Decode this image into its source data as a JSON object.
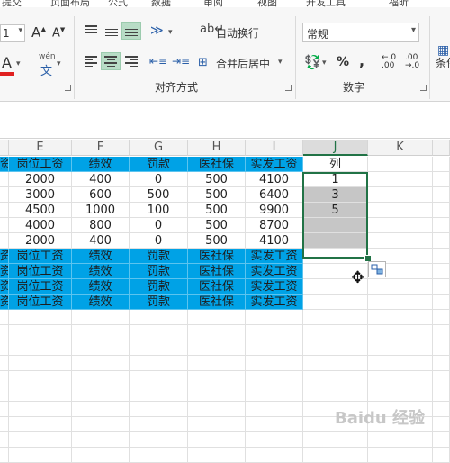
{
  "menu": [
    "提交",
    "页面布局",
    "公式",
    "数据",
    "审阅",
    "视图",
    "开发工具",
    "福昕"
  ],
  "ribbon": {
    "font": {
      "size_value": "1",
      "grow_icon": "font-grow-icon",
      "shrink_icon": "font-shrink-icon",
      "font_color_label": "A",
      "wen_label": "wén",
      "wen_char": "文"
    },
    "alignment": {
      "wrap_text_label": "自动换行",
      "merge_center_label": "合并后居中",
      "group_label": "对齐方式"
    },
    "number": {
      "format_value": "常规",
      "percent_label": "%",
      "comma_label": ",",
      "inc_decimal_label": "←.0 .00",
      "dec_decimal_label": ".00 →.0",
      "group_label": "数字"
    },
    "cut_label": "条件"
  },
  "columns": [
    "E",
    "F",
    "G",
    "H",
    "I",
    "J",
    "K"
  ],
  "headers": [
    "资",
    "岗位工资",
    "绩效",
    "罚款",
    "医社保",
    "实发工资",
    "列"
  ],
  "rows": [
    [
      "",
      "2000",
      "400",
      "0",
      "500",
      "4100",
      "1"
    ],
    [
      "",
      "3000",
      "600",
      "500",
      "500",
      "6400",
      "3"
    ],
    [
      "",
      "4500",
      "1000",
      "100",
      "500",
      "9900",
      "5"
    ],
    [
      "",
      "4000",
      "800",
      "0",
      "500",
      "8700",
      ""
    ],
    [
      "",
      "2000",
      "400",
      "0",
      "500",
      "4100",
      ""
    ]
  ],
  "blue_rows": [
    [
      "资",
      "岗位工资",
      "绩效",
      "罚款",
      "医社保",
      "实发工资"
    ],
    [
      "资",
      "岗位工资",
      "绩效",
      "罚款",
      "医社保",
      "实发工资"
    ],
    [
      "资",
      "岗位工资",
      "绩效",
      "罚款",
      "医社保",
      "实发工资"
    ],
    [
      "资",
      "岗位工资",
      "绩效",
      "罚款",
      "医社保",
      "实发工资"
    ]
  ],
  "colors": {
    "header_blue": "#00a2e6",
    "selection_gray": "#c6c6c6",
    "excel_green": "#217346",
    "active_button": "#b8dcc6"
  },
  "watermark": "Baidu 经验"
}
